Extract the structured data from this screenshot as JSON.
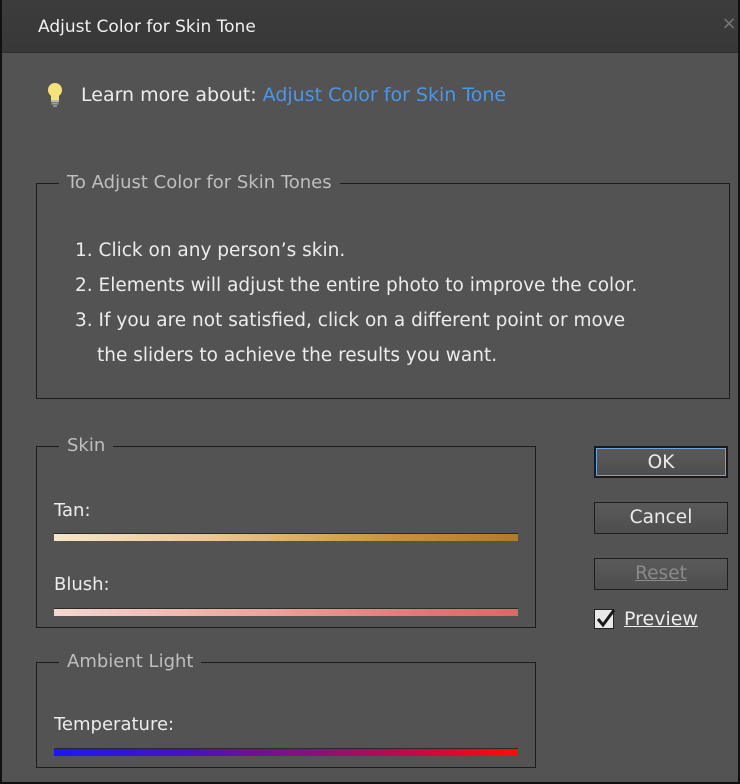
{
  "window": {
    "title": "Adjust Color for Skin Tone",
    "close_glyph": "×"
  },
  "learn_more": {
    "prefix": "Learn more about: ",
    "link": "Adjust Color for Skin Tone",
    "icon": "lightbulb-icon"
  },
  "instructions": {
    "legend": "To Adjust Color for Skin Tones",
    "lines": [
      "1. Click on any person’s skin.",
      "2. Elements will adjust the entire photo to improve the color.",
      "3. If you are not satisfied, click on a different point or move",
      "the sliders to achieve the results you want."
    ]
  },
  "skin_group": {
    "legend": "Skin",
    "tan_label": "Tan:",
    "blush_label": "Blush:"
  },
  "ambient_group": {
    "legend": "Ambient Light",
    "temperature_label": "Temperature:"
  },
  "buttons": {
    "ok": "OK",
    "cancel": "Cancel",
    "reset": "Reset"
  },
  "preview": {
    "label": "Preview",
    "checked": true
  },
  "colors": {
    "dialog_bg": "#535353",
    "link": "#4a97ea",
    "ok_focus": "#6ea4e0",
    "temperature_start": "#1a19f0",
    "temperature_end": "#ff0a0a"
  }
}
